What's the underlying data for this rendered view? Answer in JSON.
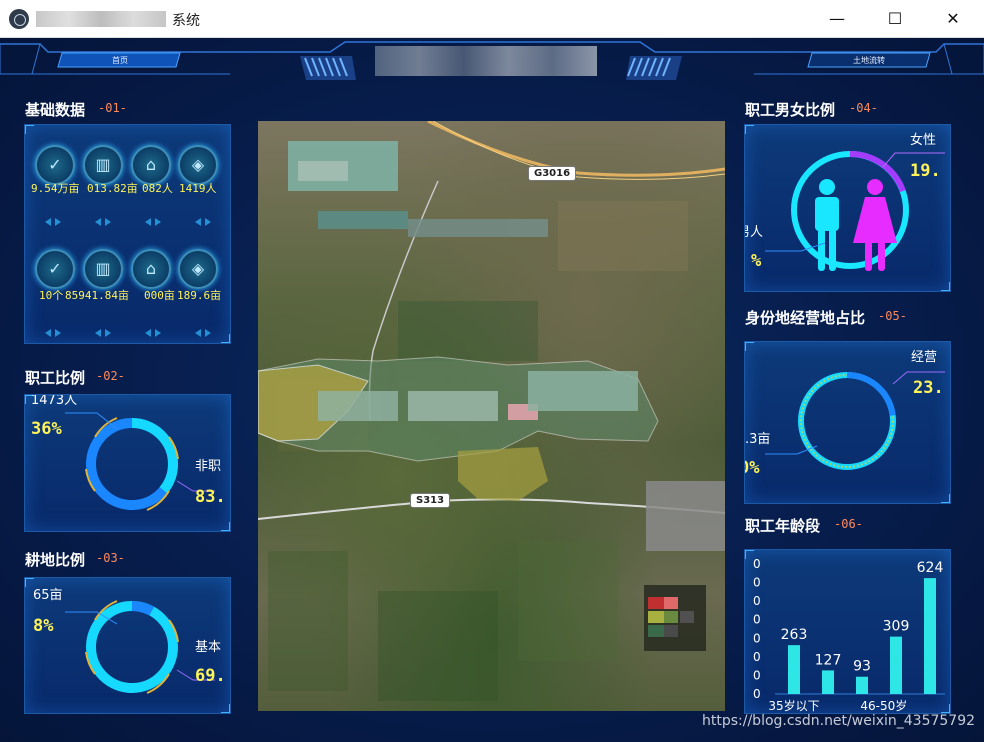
{
  "window": {
    "title": "系统",
    "buttons": {
      "minimize": "—",
      "maximize": "☐",
      "close": "✕"
    }
  },
  "nav": {
    "left_tab": "首页",
    "right_tab": "土地流转"
  },
  "sections": {
    "basic": {
      "title": "基础数据",
      "code": "-01-"
    },
    "staff_ratio": {
      "title": "职工比例",
      "code": "-02-"
    },
    "farmland_ratio": {
      "title": "耕地比例",
      "code": "-03-"
    },
    "gender_ratio": {
      "title": "职工男女比例",
      "code": "-04-"
    },
    "identity_ratio": {
      "title": "身份地经营地占比",
      "code": "-05-"
    },
    "age_groups": {
      "title": "职工年龄段",
      "code": "-06-"
    }
  },
  "basic_stats": {
    "row1": [
      {
        "icon": "leaf-icon",
        "value": "9.54万亩"
      },
      {
        "icon": "bar-chart-icon",
        "value": "013.82亩"
      },
      {
        "icon": "house-icon",
        "value": "082人"
      },
      {
        "icon": "shield-icon",
        "value": "1419人"
      }
    ],
    "row2": [
      {
        "icon": "leaf-icon",
        "value": "10个"
      },
      {
        "icon": "bar-chart-icon",
        "value": "85941.84亩"
      },
      {
        "icon": "house-icon",
        "value": "000亩"
      },
      {
        "icon": "shield-icon",
        "value": "189.6亩"
      }
    ]
  },
  "staff_ratio": {
    "top_label": "1473人",
    "left_pct": "36%",
    "right_label": "非职",
    "right_value": "83.",
    "ring_fraction": 0.36,
    "colors": {
      "ring_a": "#1a86ff",
      "ring_b": "#16d9ff",
      "arc": "#e0b43a"
    }
  },
  "farmland_ratio": {
    "top_label": "65亩",
    "left_pct": "8%",
    "right_label": "基本",
    "right_value": "69.",
    "ring_fraction": 0.08,
    "colors": {
      "ring_a": "#1a86ff",
      "ring_b": "#16d9ff",
      "arc": "#e0b43a"
    }
  },
  "gender_ratio": {
    "right_label": "女性",
    "right_value": "19.",
    "left_label": "男人",
    "left_value": "%",
    "colors": {
      "male": "#19e6ff",
      "female": "#e72cff"
    }
  },
  "identity_ratio": {
    "right_label": "经营",
    "right_value": "23.",
    "left_label": ".3亩",
    "left_value": "0%",
    "ring_fraction": 0.23,
    "colors": {
      "ring_a": "#1a86ff",
      "ring_b": "#16d9ff",
      "arc": "#e0b43a"
    }
  },
  "map": {
    "roads": [
      "G3016",
      "S313"
    ]
  },
  "chart_data": {
    "type": "bar",
    "categories": [
      "35岁以下",
      "",
      "",
      "46-50岁",
      ""
    ],
    "values": [
      263,
      127,
      93,
      309,
      624
    ],
    "ylim": [
      0,
      700
    ],
    "ytick_labels": [
      "0",
      "0",
      "0",
      "0",
      "0",
      "0",
      "0",
      "0"
    ],
    "xtick_labels": [
      "35岁以下",
      "46-50岁"
    ],
    "bar_color": "#2ee6e6",
    "value_color": "#ffffff"
  },
  "watermark": "https://blog.csdn.net/weixin_43575792"
}
